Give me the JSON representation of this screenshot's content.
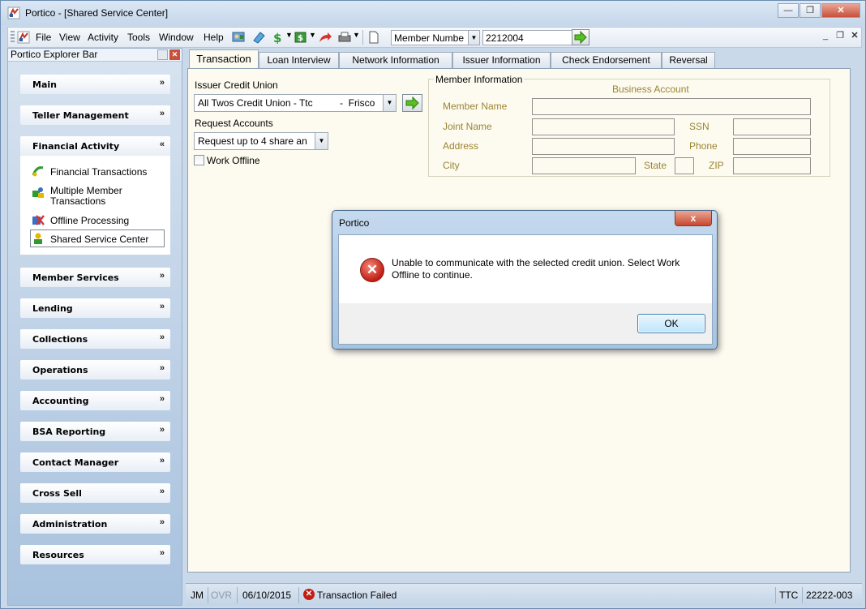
{
  "window": {
    "title": "Portico - [Shared Service Center]",
    "caption_buttons": [
      "minimize",
      "restore",
      "close"
    ]
  },
  "menu": {
    "items": [
      "File",
      "View",
      "Activity",
      "Tools",
      "Window",
      "Help"
    ]
  },
  "toolbar": {
    "icons": [
      "member-search-icon",
      "receipt-icon",
      "dollar-icon",
      "cash-icon",
      "forward-arrow-icon",
      "printer-icon",
      "document-icon"
    ],
    "member_field_select": "Member Numbe",
    "member_number": "2212004"
  },
  "explorer": {
    "title": "Portico Explorer Bar",
    "groups": [
      {
        "label": "Main",
        "chevron": "»",
        "expanded": false
      },
      {
        "label": "Teller Management",
        "chevron": "»",
        "expanded": false
      },
      {
        "label": "Financial Activity",
        "chevron": "«",
        "expanded": true
      },
      {
        "label": "Member Services",
        "chevron": "»",
        "expanded": false
      },
      {
        "label": "Lending",
        "chevron": "»",
        "expanded": false
      },
      {
        "label": "Collections",
        "chevron": "»",
        "expanded": false
      },
      {
        "label": "Operations",
        "chevron": "»",
        "expanded": false
      },
      {
        "label": "Accounting",
        "chevron": "»",
        "expanded": false
      },
      {
        "label": "BSA Reporting",
        "chevron": "»",
        "expanded": false
      },
      {
        "label": "Contact Manager",
        "chevron": "»",
        "expanded": false
      },
      {
        "label": "Cross Sell",
        "chevron": "»",
        "expanded": false
      },
      {
        "label": "Administration",
        "chevron": "»",
        "expanded": false
      },
      {
        "label": "Resources",
        "chevron": "»",
        "expanded": false
      }
    ],
    "financial_activity_items": [
      {
        "label": "Financial Transactions",
        "icon": "financial-transactions-icon"
      },
      {
        "label": "Multiple Member\nTransactions",
        "icon": "multiple-member-icon"
      },
      {
        "label": "Offline Processing",
        "icon": "offline-processing-icon"
      },
      {
        "label": "Shared Service Center",
        "icon": "shared-service-icon",
        "selected": true
      }
    ]
  },
  "tabs": [
    {
      "label": "Transaction",
      "active": true
    },
    {
      "label": "Loan Interview"
    },
    {
      "label": "Network Information"
    },
    {
      "label": "Issuer Information"
    },
    {
      "label": "Check Endorsement"
    },
    {
      "label": "Reversal"
    }
  ],
  "form": {
    "issuer_label": "Issuer Credit Union",
    "issuer_value": "All Twos Credit Union - Ttc          -  Frisco",
    "request_label": "Request Accounts",
    "request_value": "Request up to 4 share an",
    "work_offline_label": "Work Offline",
    "work_offline_checked": false
  },
  "member_info": {
    "title": "Member Information",
    "account_type": "Business Account",
    "fields": {
      "member_name": "Member Name",
      "joint_name": "Joint Name",
      "ssn": "SSN",
      "address": "Address",
      "phone": "Phone",
      "city": "City",
      "state": "State",
      "zip": "ZIP"
    }
  },
  "status": {
    "user": "JM",
    "ovr": "OVR",
    "date": "06/10/2015",
    "message": "Transaction Failed",
    "branch": "TTC",
    "code": "22222-003"
  },
  "dialog": {
    "title": "Portico",
    "message": "Unable to communicate with the selected credit union. Select Work Offline to continue.",
    "ok_label": "OK",
    "close_glyph": "x"
  },
  "colors": {
    "field_label": "#9a8432",
    "error_red": "#c31d14",
    "panel_bg": "#fdfbf0"
  }
}
